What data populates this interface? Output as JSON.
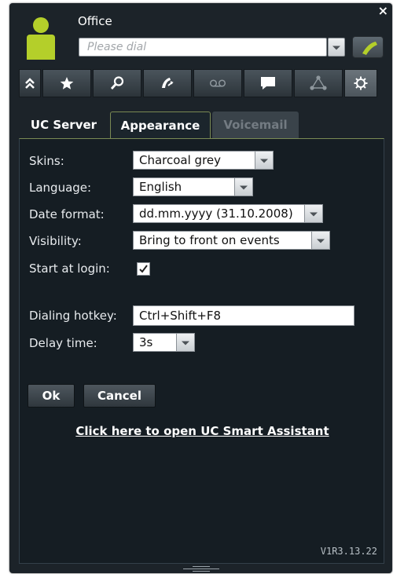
{
  "window": {
    "title": "Office",
    "close_glyph": "×"
  },
  "dial": {
    "placeholder": "Please dial"
  },
  "toolbar": {
    "icons": [
      "collapse-icon",
      "favorites-star-icon",
      "search-icon",
      "call-forward-icon",
      "voicemail-icon",
      "chat-icon",
      "conference-icon",
      "settings-gear-icon"
    ],
    "selected": "settings-gear-icon"
  },
  "tabs": {
    "uc_server": "UC Server",
    "appearance": "Appearance",
    "voicemail": "Voicemail",
    "active": "Appearance"
  },
  "settings": {
    "skins_label": "Skins:",
    "skins_value": "Charcoal grey",
    "language_label": "Language:",
    "language_value": "English",
    "date_format_label": "Date format:",
    "date_format_value": "dd.mm.yyyy (31.10.2008)",
    "visibility_label": "Visibility:",
    "visibility_value": "Bring to front on events",
    "start_at_login_label": "Start at login:",
    "start_at_login_checked": true,
    "dialing_hotkey_label": "Dialing hotkey:",
    "dialing_hotkey_value": "Ctrl+Shift+F8",
    "delay_time_label": "Delay time:",
    "delay_time_value": "3s"
  },
  "buttons": {
    "ok": "Ok",
    "cancel": "Cancel"
  },
  "link": {
    "smart_assistant": "Click here to open UC Smart Assistant"
  },
  "footer": {
    "version": "V1R3.13.22"
  },
  "colors": {
    "background": "#1c2329",
    "panel": "#151d23",
    "accent_green": "#b4cf2a",
    "tab_border": "#7a8a54"
  }
}
